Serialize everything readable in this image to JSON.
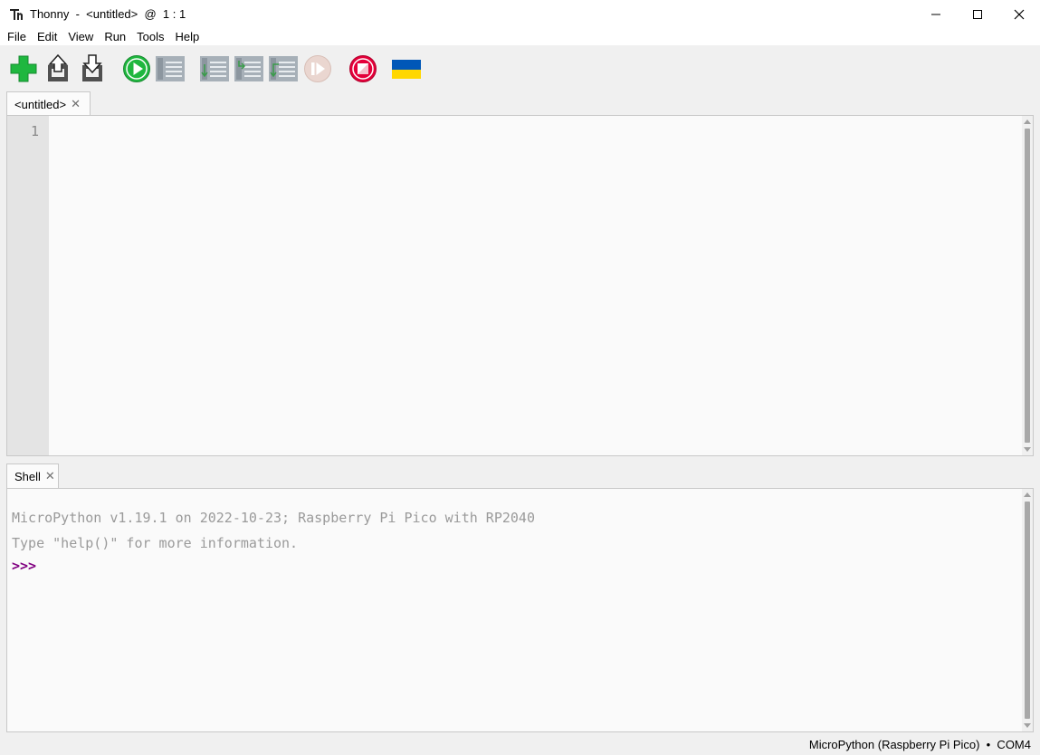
{
  "window": {
    "title": "Thonny  -  <untitled>  @  1 : 1",
    "minimize_icon": "minimize-icon",
    "maximize_icon": "maximize-icon",
    "close_icon": "close-icon"
  },
  "menu": {
    "items": [
      "File",
      "Edit",
      "View",
      "Run",
      "Tools",
      "Help"
    ]
  },
  "toolbar": {
    "buttons": [
      {
        "name": "new-file",
        "icon": "green-plus-icon"
      },
      {
        "name": "open-file",
        "icon": "open-icon"
      },
      {
        "name": "save-file",
        "icon": "save-icon"
      },
      {
        "name": "run",
        "icon": "green-run-icon"
      },
      {
        "name": "debug",
        "icon": "debug-icon"
      },
      {
        "name": "step-over",
        "icon": "step-over-icon"
      },
      {
        "name": "step-into",
        "icon": "step-into-icon"
      },
      {
        "name": "step-out",
        "icon": "step-out-icon"
      },
      {
        "name": "resume",
        "icon": "resume-icon"
      },
      {
        "name": "stop",
        "icon": "red-stop-icon"
      },
      {
        "name": "ukraine-flag",
        "icon": "ukraine-flag-icon"
      }
    ],
    "colors": {
      "green": "#1fb73f",
      "red": "#e4003a",
      "disabled": "#a7b0b8",
      "flag_blue": "#0057b8",
      "flag_yellow": "#ffd700"
    }
  },
  "editor": {
    "tab_label": "<untitled>",
    "line_numbers": [
      "1"
    ]
  },
  "shell": {
    "tab_label": "Shell",
    "lines": [
      "MicroPython v1.19.1 on 2022-10-23; Raspberry Pi Pico with RP2040",
      "Type \"help()\" for more information."
    ],
    "prompt": ">>>"
  },
  "status": {
    "text": "MicroPython (Raspberry Pi Pico)  •  COM4"
  }
}
